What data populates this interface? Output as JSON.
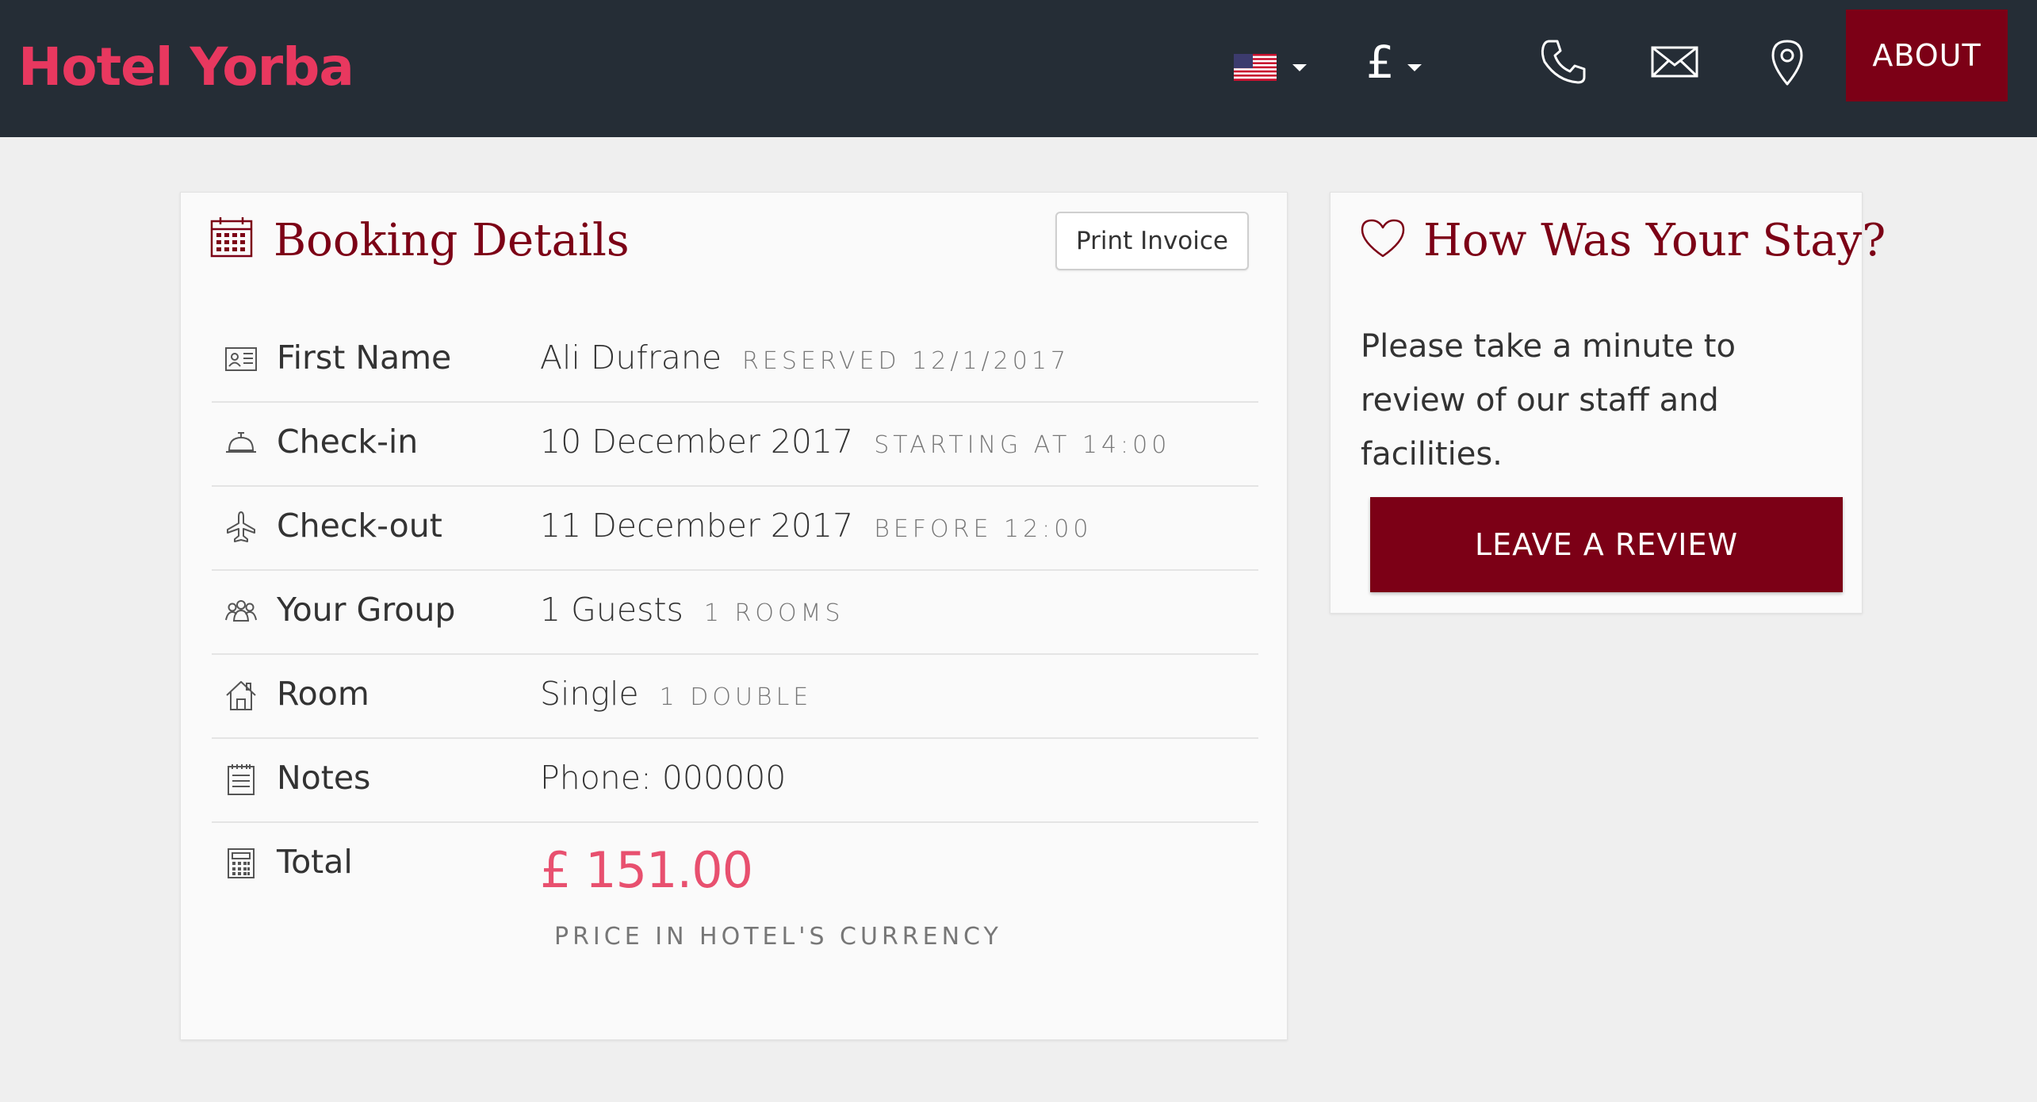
{
  "header": {
    "logo": "Hotel Yorba",
    "language_flag": "us-flag-icon",
    "currency_symbol": "£",
    "icons": [
      "phone-icon",
      "mail-icon",
      "location-pin-icon"
    ],
    "about_label": "ABOUT"
  },
  "booking": {
    "title": "Booking Details",
    "print_label": "Print Invoice",
    "rows": [
      {
        "icon": "id-card-icon",
        "label": "First Name",
        "value": "Ali Dufrane",
        "sub": "RESERVED 12/1/2017"
      },
      {
        "icon": "service-bell-icon",
        "label": "Check-in",
        "value": "10 December 2017",
        "sub": "STARTING AT 14:00"
      },
      {
        "icon": "airplane-icon",
        "label": "Check-out",
        "value": "11 December 2017",
        "sub": "BEFORE 12:00"
      },
      {
        "icon": "group-icon",
        "label": "Your Group",
        "value": "1 Guests",
        "sub": "1 ROOMS"
      },
      {
        "icon": "house-icon",
        "label": "Room",
        "value": "Single",
        "sub": "1 DOUBLE"
      },
      {
        "icon": "notepad-icon",
        "label": "Notes",
        "value": "Phone: 000000",
        "sub": ""
      },
      {
        "icon": "calculator-icon",
        "label": "Total",
        "value": "£ 151.00",
        "sub": "PRICE IN HOTEL'S CURRENCY"
      }
    ]
  },
  "review": {
    "title": "How Was Your Stay?",
    "text": "Please take a minute to review of our staff and facilities.",
    "button_label": "LEAVE A REVIEW"
  },
  "colors": {
    "header_bg": "#252d36",
    "logo": "#e8385f",
    "brand_red": "#7c0016",
    "total_pink": "#e8506f",
    "page_bg": "#efefef"
  }
}
